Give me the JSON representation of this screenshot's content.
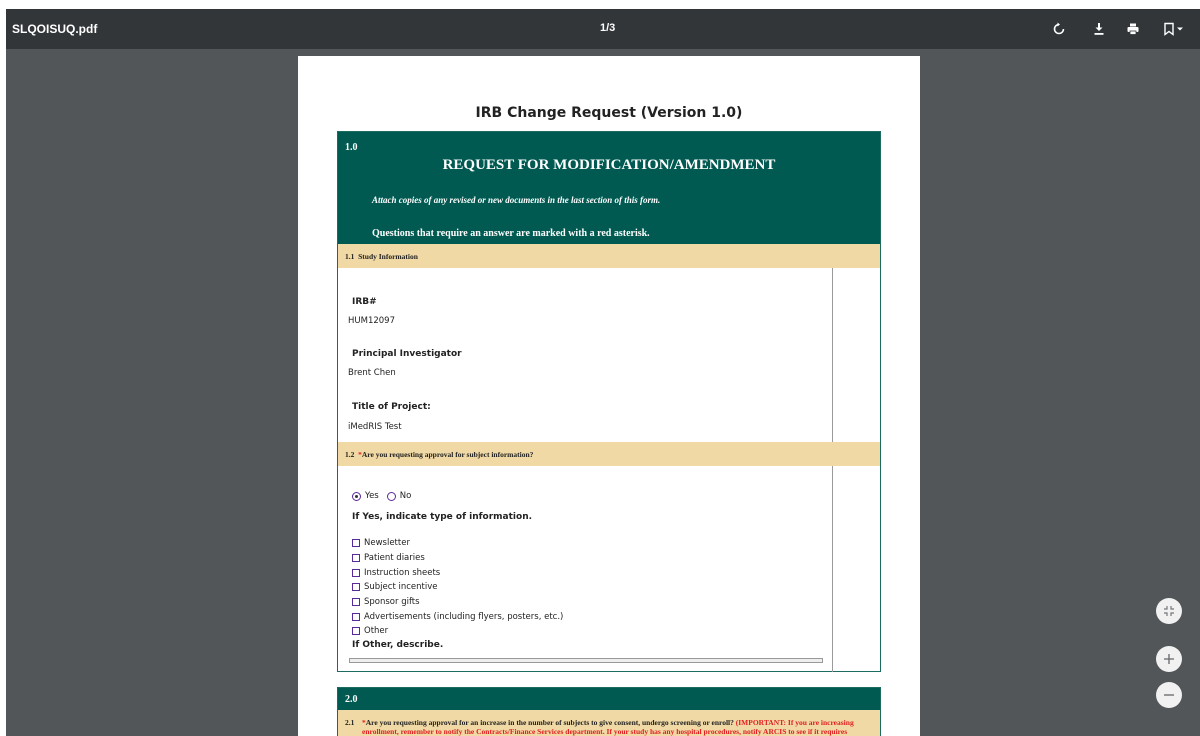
{
  "toolbar": {
    "filename": "SLQOISUQ.pdf",
    "page_indicator": "1/3",
    "icons": [
      "rotate-icon",
      "download-icon",
      "print-icon",
      "bookmark-icon",
      "chevron-down-icon"
    ]
  },
  "document": {
    "title": "IRB Change Request (Version 1.0)",
    "section1": {
      "number": "1.0",
      "heading": "REQUEST FOR MODIFICATION/AMENDMENT",
      "attach_note": "Attach copies of any revised or new documents in the last section of this form.",
      "questions_note": "Questions that require an answer are marked with a red asterisk.",
      "q11": {
        "num": "1.1",
        "label": "Study Information"
      },
      "irb_label": "IRB#",
      "irb_value": "HUM12097",
      "pi_label": "Principal Investigator",
      "pi_value": "Brent Chen",
      "title_label": "Title of Project:",
      "title_value": "iMedRIS Test",
      "q12": {
        "num": "1.2",
        "star": "*",
        "label": "Are you requesting approval for subject information?"
      },
      "radio_yes": "Yes",
      "radio_no": "No",
      "radio_selected": "Yes",
      "if_yes_label": "If Yes, indicate type of information.",
      "checkboxes": [
        "Newsletter",
        "Patient diaries",
        "Instruction sheets",
        "Subject incentive",
        "Sponsor gifts",
        "Advertisements (including flyers, posters, etc.)",
        "Other"
      ],
      "if_other_label": "If Other, describe."
    },
    "section2": {
      "number": "2.0",
      "q21_num": "2.1",
      "q21_star": "*",
      "q21_text": "Are you requesting approval for an increase in the number of subjects to give consent, undergo screening or enroll?",
      "q21_important": "(IMPORTANT: If you are increasing enrollment, remember to notify the Contracts/Finance Services department. If your study has any hospital",
      "q21_line3": "procedures, notify ARCIS to see if it requires further review.)"
    }
  },
  "colors": {
    "toolbar_bg": "#323639",
    "viewer_bg": "#525659",
    "section_header": "#005a51",
    "question_bar": "#f0d9a5",
    "required": "#e02020"
  },
  "zoom_controls": [
    "fit-page-icon",
    "zoom-in-icon",
    "zoom-out-icon"
  ]
}
